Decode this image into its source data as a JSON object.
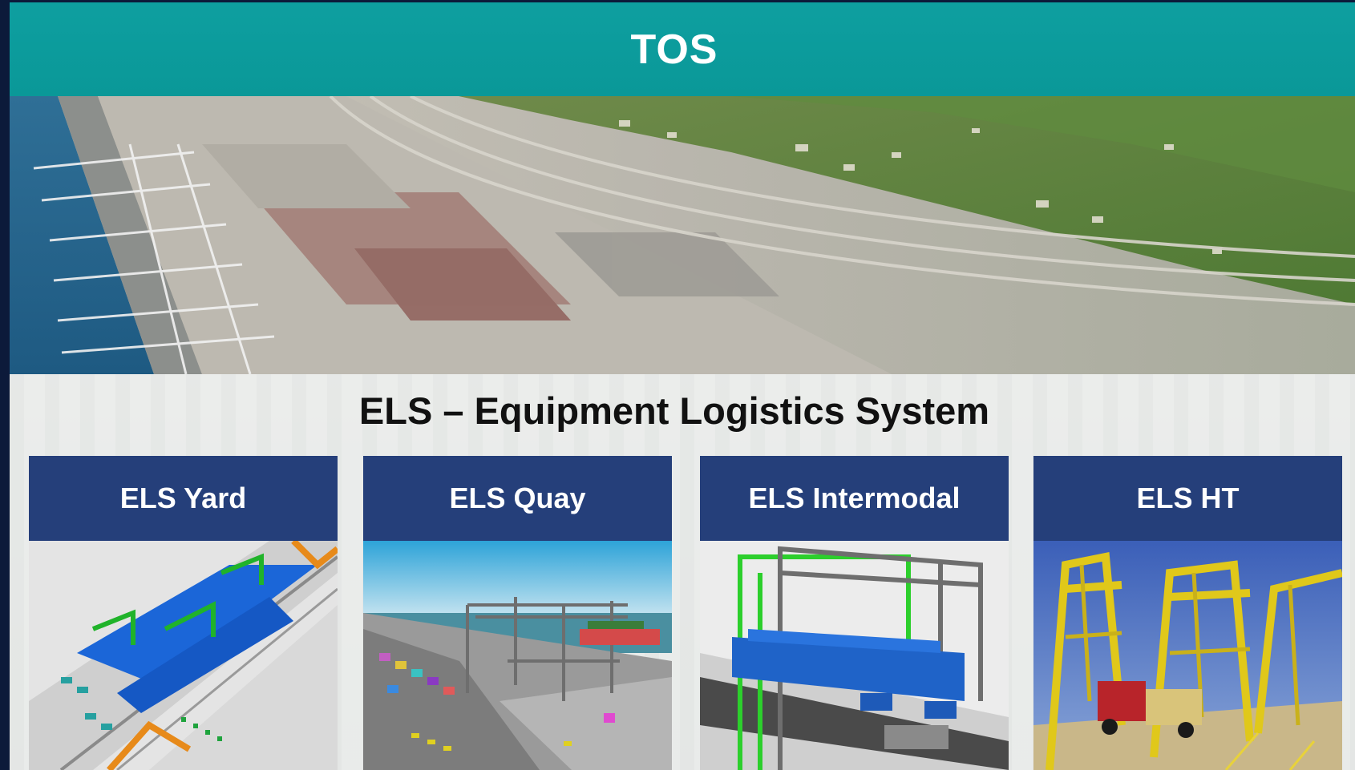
{
  "header": {
    "title": "TOS"
  },
  "section": {
    "title": "ELS – Equipment Logistics System"
  },
  "cards": [
    {
      "label": "ELS Yard",
      "image": "yard-3d-render"
    },
    {
      "label": "ELS Quay",
      "image": "quay-3d-render"
    },
    {
      "label": "ELS Intermodal",
      "image": "intermodal-3d-render"
    },
    {
      "label": "ELS HT",
      "image": "straddle-carrier-photo"
    }
  ],
  "colors": {
    "banner": "#0a9898",
    "card_header": "#253f7a",
    "background": "#0c1a3a"
  }
}
